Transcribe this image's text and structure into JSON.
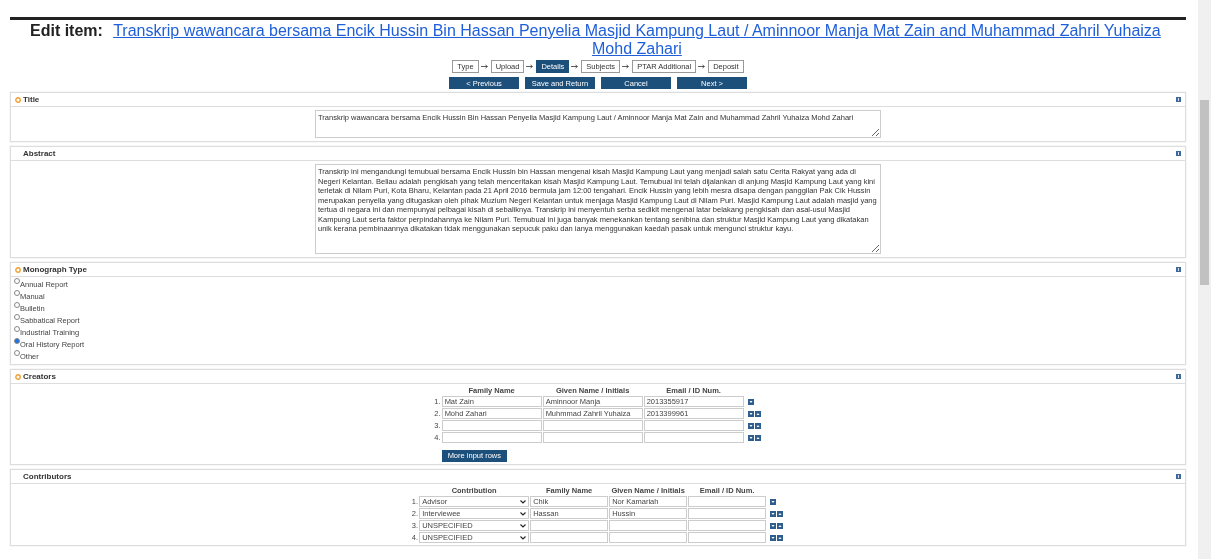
{
  "heading": {
    "label": "Edit item:",
    "link": "Transkrip wawancara bersama Encik Hussin Bin Hassan Penyelia Masjid Kampung Laut / Aminnoor Manja Mat Zain and Muhammad Zahril Yuhaiza Mohd Zahari"
  },
  "steps": [
    {
      "label": "Type",
      "selected": false
    },
    {
      "label": "Upload",
      "selected": false
    },
    {
      "label": "Details",
      "selected": true
    },
    {
      "label": "Subjects",
      "selected": false
    },
    {
      "label": "PTAR Additional",
      "selected": false
    },
    {
      "label": "Deposit",
      "selected": false
    }
  ],
  "nav_buttons": [
    "< Previous",
    "Save and Return",
    "Cancel",
    "Next >"
  ],
  "sections": [
    {
      "kind": "text",
      "title": "Title",
      "required": true,
      "value": "Transkrip wawancara bersama Encik Hussin Bin Hassan Penyelia Masjid Kampung Laut / Aminnoor Manja Mat Zain and Muhammad Zahril Yuhaiza Mohd Zahari"
    },
    {
      "kind": "longtext",
      "title": "Abstract",
      "required": false,
      "value": "Transkrip ini mengandungi temubual bersama Encik Hussin bin Hassan mengenai kisah Masjid Kampung Laut yang menjadi salah satu Cerita Rakyat yang ada di Negeri Kelantan. Beliau adalah pengkisah yang telah menceritakan kisah Masjid Kampung Laut. Temubual ini telah dijalankan di anjung Masjid Kampung Laut yang kini terletak di Nilam Puri, Kota Bharu, Kelantan pada 21 April 2016 bermula jam 12:00 tengahari. Encik Hussin yang lebih mesra disapa dengan panggilan Pak Cik Hussin merupakan penyelia yang ditugaskan oleh pihak Muzium Negeri Kelantan untuk menjaga Masjid Kampung Laut di Nilam Puri. Masjid Kampung Laut adalah masjid yang tertua di negara ini dan mempunyai pelbagai kisah di sebaliknya. Transkrip ini menyentuh serba sedikit mengenai latar belakang pengkisah dan asal-usul Masjid Kampung Laut serta faktor perpindahannya ke Nilam Puri. Temubual ini juga banyak menekankan tentang senibina dan struktur Masjid Kampung Laut yang dikatakan unik kerana pembinaannya dikatakan tidak menggunakan sepucuk paku dan ianya menggunakan kaedah pasak untuk mengunci struktur kayu."
    },
    {
      "kind": "radio",
      "title": "Monograph Type",
      "required": true,
      "options": [
        {
          "label": "Annual Report",
          "selected": false
        },
        {
          "label": "Manual",
          "selected": false
        },
        {
          "label": "Bulletin",
          "selected": false
        },
        {
          "label": "Sabbatical Report",
          "selected": false
        },
        {
          "label": "Industrial Training",
          "selected": false
        },
        {
          "label": "Oral History Report",
          "selected": true
        },
        {
          "label": "Other",
          "selected": false
        }
      ]
    },
    {
      "kind": "names",
      "title": "Creators",
      "required": true,
      "columns": [
        "Family Name",
        "Given Name / Initials",
        "Email / ID Num."
      ],
      "more_button": "More input rows",
      "rows": [
        {
          "number": "1.",
          "values": [
            "Mat Zain",
            "Aminnoor Manja",
            "2013355917"
          ],
          "can_move_up": false
        },
        {
          "number": "2.",
          "values": [
            "Mohd Zahari",
            "Muhmmad Zahril Yuhaiza",
            "2013399961"
          ],
          "can_move_up": true
        },
        {
          "number": "3.",
          "values": [],
          "can_move_up": true
        },
        {
          "number": "4.",
          "values": [],
          "can_move_up": true
        }
      ]
    },
    {
      "kind": "contributors",
      "title": "Contributors",
      "required": false,
      "columns": [
        "Contribution",
        "Family Name",
        "Given Name / Initials",
        "Email / ID Num."
      ],
      "rows": [
        {
          "number": "1.",
          "contribution": "Advisor",
          "values": [
            "Chik",
            "Nor Kamariah"
          ],
          "can_move_up": false
        },
        {
          "number": "2.",
          "contribution": "Interviewee",
          "values": [
            "Hassan",
            "Hussin"
          ],
          "can_move_up": true
        },
        {
          "number": "3.",
          "contribution": "UNSPECIFIED",
          "values": [],
          "can_move_up": true
        },
        {
          "number": "4.",
          "contribution": "UNSPECIFIED",
          "values": [],
          "can_move_up": true
        }
      ]
    }
  ]
}
